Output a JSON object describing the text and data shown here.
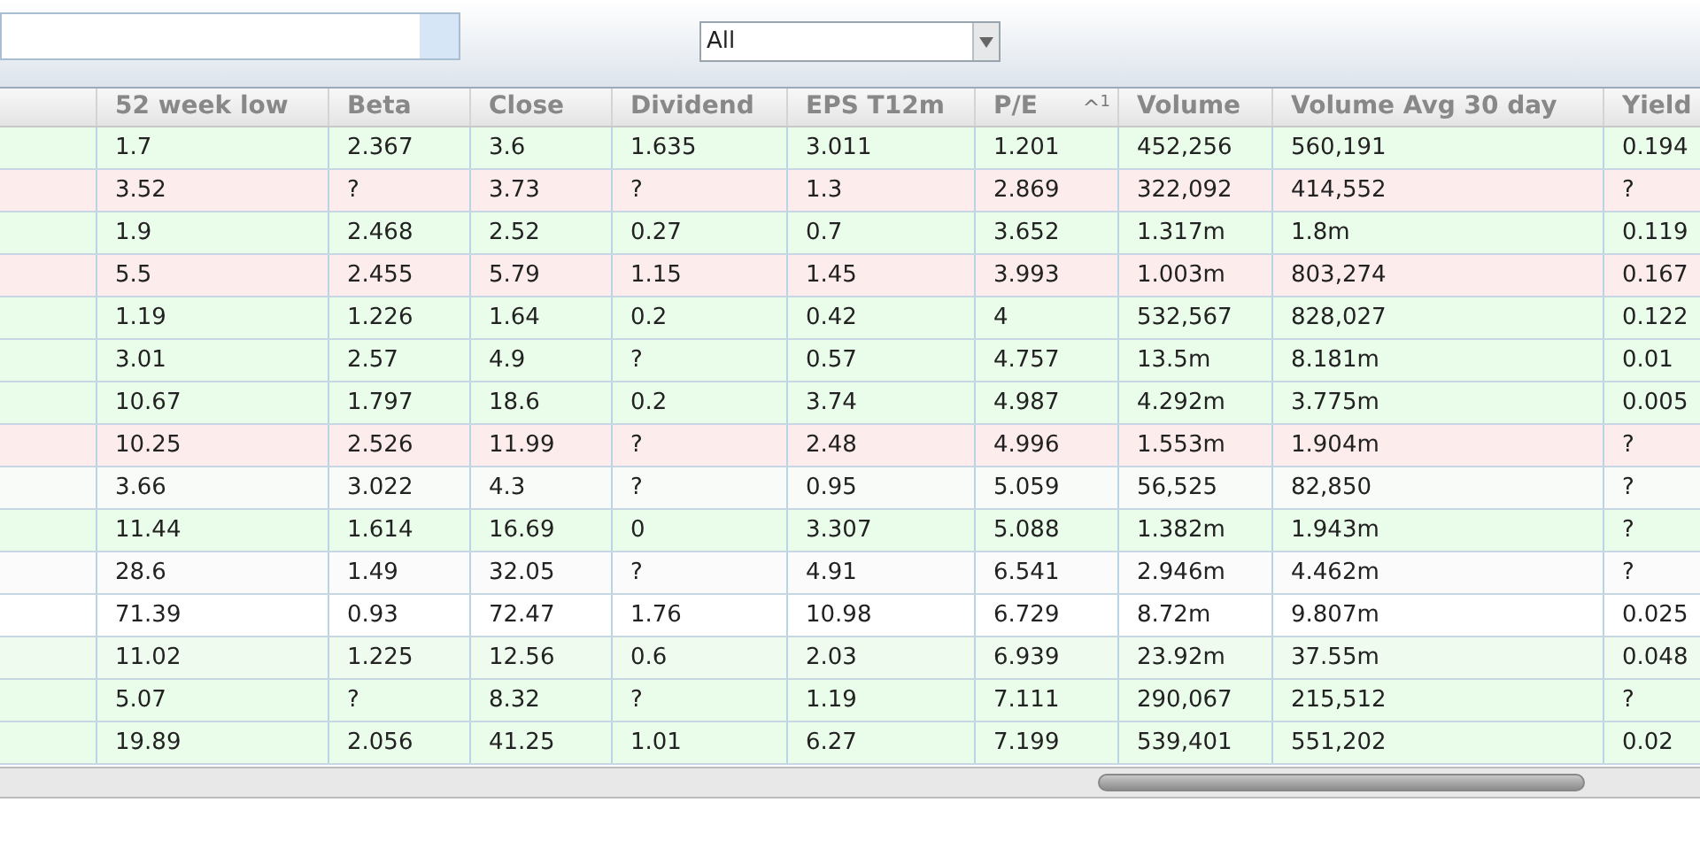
{
  "toolbar": {
    "filter": {
      "value": "All"
    }
  },
  "table": {
    "columns": [
      {
        "label": "52 week low"
      },
      {
        "label": "Beta"
      },
      {
        "label": "Close"
      },
      {
        "label": "Dividend"
      },
      {
        "label": "EPS T12m"
      },
      {
        "label": "P/E",
        "sort_indicator": "^$^{1}$"
      },
      {
        "label": "Volume"
      },
      {
        "label": "Volume Avg 30 day"
      },
      {
        "label": "Yield"
      }
    ],
    "rows": [
      {
        "color": "#eafcea",
        "cells": [
          "1.7",
          "2.367",
          "3.6",
          "1.635",
          "3.011",
          "1.201",
          "452,256",
          "560,191",
          "0.194"
        ]
      },
      {
        "color": "#fdecec",
        "cells": [
          "3.52",
          "?",
          "3.73",
          "?",
          "1.3",
          "2.869",
          "322,092",
          "414,552",
          "?"
        ]
      },
      {
        "color": "#eafcea",
        "cells": [
          "1.9",
          "2.468",
          "2.52",
          "0.27",
          "0.7",
          "3.652",
          "1.317m",
          "1.8m",
          "0.119"
        ]
      },
      {
        "color": "#fdecec",
        "cells": [
          "5.5",
          "2.455",
          "5.79",
          "1.15",
          "1.45",
          "3.993",
          "1.003m",
          "803,274",
          "0.167"
        ]
      },
      {
        "color": "#eafcea",
        "cells": [
          "1.19",
          "1.226",
          "1.64",
          "0.2",
          "0.42",
          "4",
          "532,567",
          "828,027",
          "0.122"
        ]
      },
      {
        "color": "#eafcea",
        "cells": [
          "3.01",
          "2.57",
          "4.9",
          "?",
          "0.57",
          "4.757",
          "13.5m",
          "8.181m",
          "0.01"
        ]
      },
      {
        "color": "#eafcea",
        "cells": [
          "10.67",
          "1.797",
          "18.6",
          "0.2",
          "3.74",
          "4.987",
          "4.292m",
          "3.775m",
          "0.005"
        ]
      },
      {
        "color": "#fdecec",
        "cells": [
          "10.25",
          "2.526",
          "11.99",
          "?",
          "2.48",
          "4.996",
          "1.553m",
          "1.904m",
          "?"
        ]
      },
      {
        "color": "#f8fbf8",
        "cells": [
          "3.66",
          "3.022",
          "4.3",
          "?",
          "0.95",
          "5.059",
          "56,525",
          "82,850",
          "?"
        ]
      },
      {
        "color": "#eafcea",
        "cells": [
          "11.44",
          "1.614",
          "16.69",
          "0",
          "3.307",
          "5.088",
          "1.382m",
          "1.943m",
          "?"
        ]
      },
      {
        "color": "#fcfbfc",
        "cells": [
          "28.6",
          "1.49",
          "32.05",
          "?",
          "4.91",
          "6.541",
          "2.946m",
          "4.462m",
          "?"
        ]
      },
      {
        "color": "#ffffff",
        "cells": [
          "71.39",
          "0.93",
          "72.47",
          "1.76",
          "10.98",
          "6.729",
          "8.72m",
          "9.807m",
          "0.025"
        ]
      },
      {
        "color": "#eefbee",
        "cells": [
          "11.02",
          "1.225",
          "12.56",
          "0.6",
          "2.03",
          "6.939",
          "23.92m",
          "37.55m",
          "0.048"
        ]
      },
      {
        "color": "#eafcea",
        "cells": [
          "5.07",
          "?",
          "8.32",
          "?",
          "1.19",
          "7.111",
          "290,067",
          "215,512",
          "?"
        ]
      },
      {
        "color": "#eafcea",
        "cells": [
          "19.89",
          "2.056",
          "41.25",
          "1.01",
          "6.27",
          "7.199",
          "539,401",
          "551,202",
          "0.02"
        ]
      }
    ]
  }
}
